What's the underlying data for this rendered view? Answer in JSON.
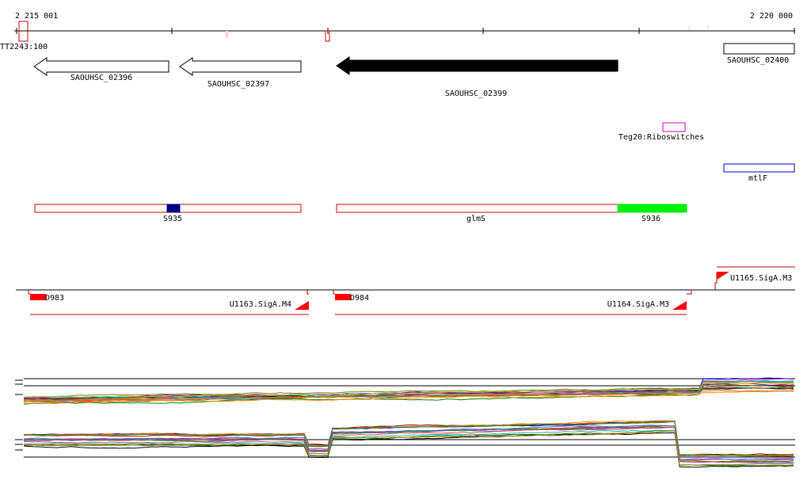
{
  "axis": {
    "start_label": "2 215 001",
    "end_label": "2 220 000"
  },
  "features": {
    "tt_label": "TT2243:100",
    "gene_02396": "SAOUHSC_02396",
    "gene_02397": "SAOUHSC_02397",
    "gene_02399": "SAOUHSC_02399",
    "gene_02400": "SAOUHSC_02400",
    "teg20": "Teg20:Riboswitches",
    "mtlf": "mtlF",
    "s935": "S935",
    "glms": "glmS",
    "s936": "S936"
  },
  "segments": {
    "u1165": "U1165.SigA.M3",
    "d983": "D983",
    "u1163": "U1163.SigA.M4",
    "d984": "D984",
    "u1164": "U1164.SigA.M3"
  },
  "colors": {
    "axis": "#000000",
    "outline_red": "#cc0000",
    "fill_red": "#ff0000",
    "fill_green": "#00ee00",
    "fill_navy": "#000080",
    "riboswitch": "#cc00cc",
    "mtlf": "#0000cc"
  },
  "expression": {
    "panel1": {
      "step_rise_at": 0.88,
      "line_colors": [
        "#000000",
        "#8b4513",
        "#ff0000",
        "#008000",
        "#0000ff",
        "#ff8c00",
        "#800080",
        "#808000",
        "#00aaaa",
        "#ff69b4",
        "#a52a2a",
        "#556b2f",
        "#9acd32",
        "#daa520",
        "#4682b4",
        "#d2691e"
      ]
    },
    "panel2": {
      "step_rise_at": 0.4,
      "step_drop_at": 0.85,
      "line_colors": [
        "#000000",
        "#8b0000",
        "#ff0000",
        "#006400",
        "#00008b",
        "#ff8c00",
        "#9932cc",
        "#808000",
        "#20b2aa",
        "#ff1493",
        "#a0522d",
        "#228b22",
        "#b8860b",
        "#4169e1",
        "#cd5c5c",
        "#2e8b57"
      ]
    }
  }
}
